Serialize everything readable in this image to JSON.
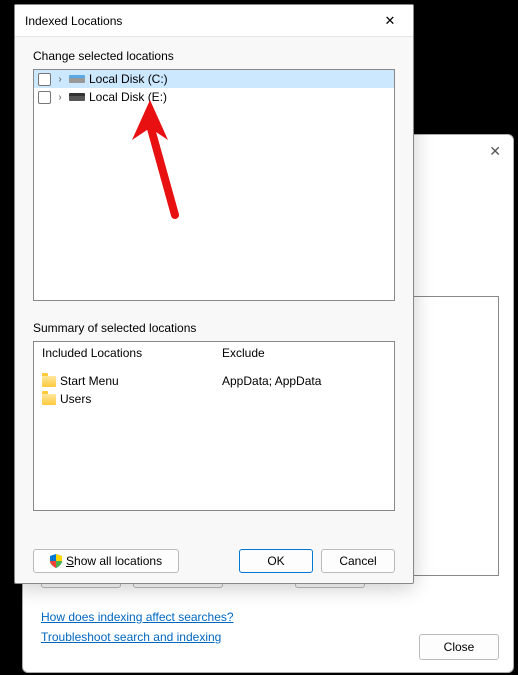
{
  "bgDialog": {
    "link1": "How does indexing affect searches?",
    "link2": "Troubleshoot search and indexing",
    "closeBtn": "Close"
  },
  "dialog": {
    "title": "Indexed Locations",
    "changeLabel": "Change selected locations",
    "tree": [
      {
        "label": "Local Disk (C:)",
        "selected": true,
        "iconVariant": "blue"
      },
      {
        "label": "Local Disk (E:)",
        "selected": false,
        "iconVariant": "dark"
      }
    ],
    "summaryLabel": "Summary of selected locations",
    "includedHeader": "Included Locations",
    "excludeHeader": "Exclude",
    "included": [
      {
        "label": "Start Menu"
      },
      {
        "label": "Users"
      }
    ],
    "excludeText": "AppData; AppData",
    "showAllPrefix": "S",
    "showAllRest": "how all locations",
    "okBtn": "OK",
    "cancelBtn": "Cancel"
  }
}
